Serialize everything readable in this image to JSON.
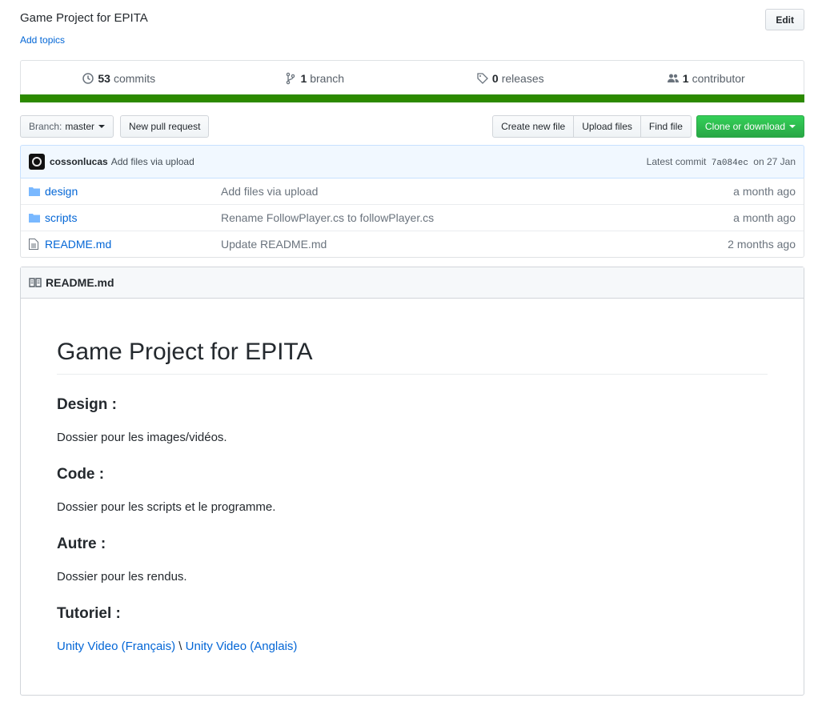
{
  "repo": {
    "description": "Game Project for EPITA",
    "add_topics": "Add topics",
    "edit": "Edit"
  },
  "summary": {
    "commits_count": "53",
    "commits_label": "commits",
    "branch_count": "1",
    "branch_label": "branch",
    "releases_count": "0",
    "releases_label": "releases",
    "contributors_count": "1",
    "contributors_label": "contributor",
    "language_bar_color": "#2c8a00"
  },
  "toolbar": {
    "branch_prefix": "Branch:",
    "branch_name": "master",
    "new_pull_request": "New pull request",
    "create_new_file": "Create new file",
    "upload_files": "Upload files",
    "find_file": "Find file",
    "clone_or_download": "Clone or download"
  },
  "latest_commit": {
    "author": "cossonlucas",
    "message": "Add files via upload",
    "label": "Latest commit",
    "sha": "7a084ec",
    "date": "on 27 Jan"
  },
  "files": [
    {
      "icon": "folder-icon",
      "name": "design",
      "message": "Add files via upload",
      "age": "a month ago"
    },
    {
      "icon": "folder-icon",
      "name": "scripts",
      "message": "Rename FollowPlayer.cs to followPlayer.cs",
      "age": "a month ago"
    },
    {
      "icon": "file-icon",
      "name": "README.md",
      "message": "Update README.md",
      "age": "2 months ago"
    }
  ],
  "readme": {
    "header": "README.md",
    "title": "Game Project for EPITA",
    "sections": [
      {
        "heading": "Design :",
        "text": "Dossier pour les images/vidéos."
      },
      {
        "heading": "Code :",
        "text": "Dossier pour les scripts et le programme."
      },
      {
        "heading": "Autre :",
        "text": "Dossier pour les rendus."
      },
      {
        "heading": "Tutoriel :"
      }
    ],
    "link_fr": "Unity Video (Français)",
    "separator": " \\ ",
    "link_en": "Unity Video (Anglais)"
  }
}
